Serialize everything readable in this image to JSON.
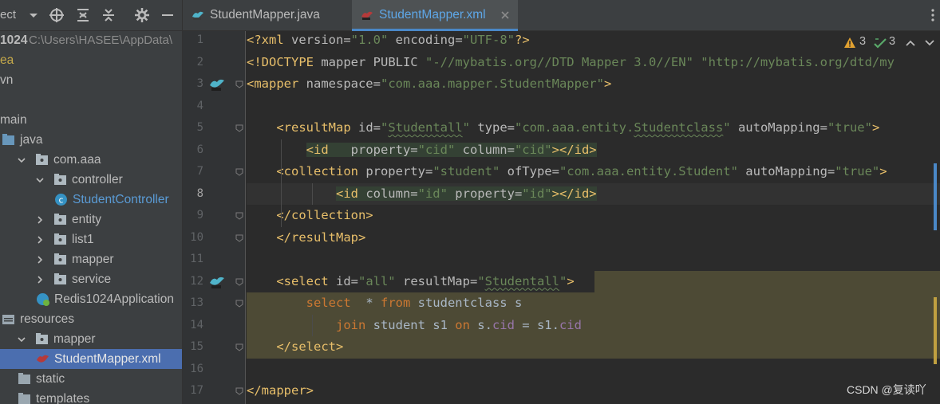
{
  "project_panel": {
    "toolbar_label": "ect",
    "tree": [
      {
        "depth": 0,
        "label": "1024",
        "extra": "C:\\Users\\HASEE\\AppData\\",
        "type": "root"
      },
      {
        "depth": 0,
        "label": "ea",
        "type": "idea"
      },
      {
        "depth": 0,
        "label": "vn",
        "type": "plain"
      },
      {
        "depth": 0,
        "label": "",
        "type": "plain"
      },
      {
        "depth": 0,
        "label": "main",
        "type": "plain"
      },
      {
        "depth": 0,
        "label": "java",
        "type": "folder-blue"
      },
      {
        "depth": 1,
        "label": "com.aaa",
        "type": "package",
        "open": true
      },
      {
        "depth": 2,
        "label": "controller",
        "type": "package",
        "open": true
      },
      {
        "depth": 3,
        "label": "StudentController",
        "type": "class"
      },
      {
        "depth": 2,
        "label": "entity",
        "type": "package",
        "open": false
      },
      {
        "depth": 2,
        "label": "list1",
        "type": "package",
        "open": false
      },
      {
        "depth": 2,
        "label": "mapper",
        "type": "package",
        "open": false
      },
      {
        "depth": 2,
        "label": "service",
        "type": "package",
        "open": false
      },
      {
        "depth": 2,
        "label": "Redis1024Application",
        "type": "springapp"
      },
      {
        "depth": 0,
        "label": "resources",
        "type": "resources"
      },
      {
        "depth": 1,
        "label": "mapper",
        "type": "package",
        "open": true
      },
      {
        "depth": 2,
        "label": "StudentMapper.xml",
        "type": "mybatis",
        "selected": true
      },
      {
        "depth": 1,
        "label": "static",
        "type": "folder"
      },
      {
        "depth": 1,
        "label": "templates",
        "type": "folder"
      }
    ]
  },
  "tabs": [
    {
      "label": "StudentMapper.java",
      "active": false,
      "icon": "mybatis-java-icon"
    },
    {
      "label": "StudentMapper.xml",
      "active": true,
      "icon": "mybatis-xml-icon"
    }
  ],
  "inspections": {
    "warnings": "3",
    "weak_warnings": "3"
  },
  "editor": {
    "current_line": 8,
    "lines": [
      {
        "n": "1",
        "tokens": [
          [
            "t-tag",
            "<?xml "
          ],
          [
            "t-attr",
            "version="
          ],
          [
            "t-val",
            "\"1.0\""
          ],
          [
            "t-attr",
            " encoding="
          ],
          [
            "t-val",
            "\"UTF-8\""
          ],
          [
            "t-tag",
            "?>"
          ]
        ]
      },
      {
        "n": "2",
        "tokens": [
          [
            "t-tag",
            "<!DOCTYPE "
          ],
          [
            "t-attr",
            "mapper PUBLIC "
          ],
          [
            "t-val",
            "\"-//mybatis.org//DTD Mapper 3.0//EN\""
          ],
          [
            "t-plain",
            " "
          ],
          [
            "t-val",
            "\"http://mybatis.org/dtd/my"
          ]
        ]
      },
      {
        "n": "3",
        "tokens": [
          [
            "t-tag",
            "<mapper "
          ],
          [
            "t-attr",
            "namespace="
          ],
          [
            "t-val",
            "\"com.aaa.mapper.StudentMapper\""
          ],
          [
            "t-tag",
            ">"
          ]
        ]
      },
      {
        "n": "4",
        "tokens": []
      },
      {
        "n": "5",
        "tokens": [
          [
            "t-plain",
            "    "
          ],
          [
            "t-tag",
            "<resultMap "
          ],
          [
            "t-attr",
            "id="
          ],
          [
            "t-val",
            "\""
          ],
          [
            "t-val wavy",
            "Studentall"
          ],
          [
            "t-val",
            "\""
          ],
          [
            "t-attr",
            " type="
          ],
          [
            "t-val",
            "\"com.aaa.entity."
          ],
          [
            "t-val wavy",
            "Studentclass"
          ],
          [
            "t-val",
            "\""
          ],
          [
            "t-attr",
            " autoMapping="
          ],
          [
            "t-val",
            "\"true\""
          ],
          [
            "t-tag",
            ">"
          ]
        ]
      },
      {
        "n": "6",
        "tokens": [
          [
            "t-plain",
            "        "
          ],
          [
            "t-tag match-box",
            "<id"
          ],
          [
            "t-attr match-box",
            "   property="
          ],
          [
            "t-val match-box",
            "\"cid\""
          ],
          [
            "t-attr match-box",
            " column="
          ],
          [
            "t-val match-box",
            "\"cid\""
          ],
          [
            "t-tag match-box",
            "></id>"
          ]
        ]
      },
      {
        "n": "7",
        "tokens": [
          [
            "t-plain",
            "    "
          ],
          [
            "t-tag",
            "<collection "
          ],
          [
            "t-attr",
            "property="
          ],
          [
            "t-val",
            "\"student\""
          ],
          [
            "t-attr",
            " ofType="
          ],
          [
            "t-val",
            "\"com.aaa.entity.Student\""
          ],
          [
            "t-attr",
            " autoMapping="
          ],
          [
            "t-val",
            "\"true\""
          ],
          [
            "t-tag",
            ">"
          ]
        ]
      },
      {
        "n": "8",
        "tokens": [
          [
            "t-plain",
            "            "
          ],
          [
            "t-tag match-box",
            "<id"
          ],
          [
            "t-attr match-box",
            " column="
          ],
          [
            "t-val match-box",
            "\"id\""
          ],
          [
            "t-attr match-box",
            " property="
          ],
          [
            "t-val match-box",
            "\"id\""
          ],
          [
            "t-tag match-box",
            "></id>"
          ]
        ]
      },
      {
        "n": "9",
        "tokens": [
          [
            "t-plain",
            "    "
          ],
          [
            "t-tag",
            "</collection>"
          ]
        ]
      },
      {
        "n": "10",
        "tokens": [
          [
            "t-plain",
            "    "
          ],
          [
            "t-tag",
            "</resultMap>"
          ]
        ]
      },
      {
        "n": "11",
        "tokens": []
      },
      {
        "n": "12",
        "tokens": [
          [
            "t-plain",
            "    "
          ],
          [
            "t-tag",
            "<select "
          ],
          [
            "t-attr",
            "id="
          ],
          [
            "t-val",
            "\"all\""
          ],
          [
            "t-attr",
            " resultMap="
          ],
          [
            "t-val",
            "\""
          ],
          [
            "t-val wavy",
            "Studentall"
          ],
          [
            "t-val",
            "\""
          ],
          [
            "t-tag",
            ">"
          ]
        ]
      },
      {
        "n": "13",
        "tokens": [
          [
            "t-plain",
            "        "
          ],
          [
            "t-kw",
            "select"
          ],
          [
            "t-plain",
            "  * "
          ],
          [
            "t-kw",
            "from"
          ],
          [
            "t-plain",
            " studentclass s"
          ]
        ]
      },
      {
        "n": "14",
        "tokens": [
          [
            "t-plain",
            "            "
          ],
          [
            "t-kw",
            "join"
          ],
          [
            "t-plain",
            " student s1 "
          ],
          [
            "t-kw",
            "on"
          ],
          [
            "t-plain",
            " s."
          ],
          [
            "t-field",
            "cid"
          ],
          [
            "t-plain",
            " = s1."
          ],
          [
            "t-field",
            "cid"
          ]
        ]
      },
      {
        "n": "15",
        "tokens": [
          [
            "t-plain",
            "    "
          ],
          [
            "t-tag",
            "</select>"
          ]
        ]
      },
      {
        "n": "16",
        "tokens": []
      },
      {
        "n": "17",
        "tokens": [
          [
            "t-tag",
            "</mapper>"
          ]
        ]
      }
    ]
  },
  "watermark": "CSDN @复读吖",
  "colors": {
    "accent": "#4a88c7",
    "selection": "#4b6eaf",
    "sql_background": "#4d4a35",
    "tag": "#e8bf6a",
    "string": "#6a8759"
  }
}
